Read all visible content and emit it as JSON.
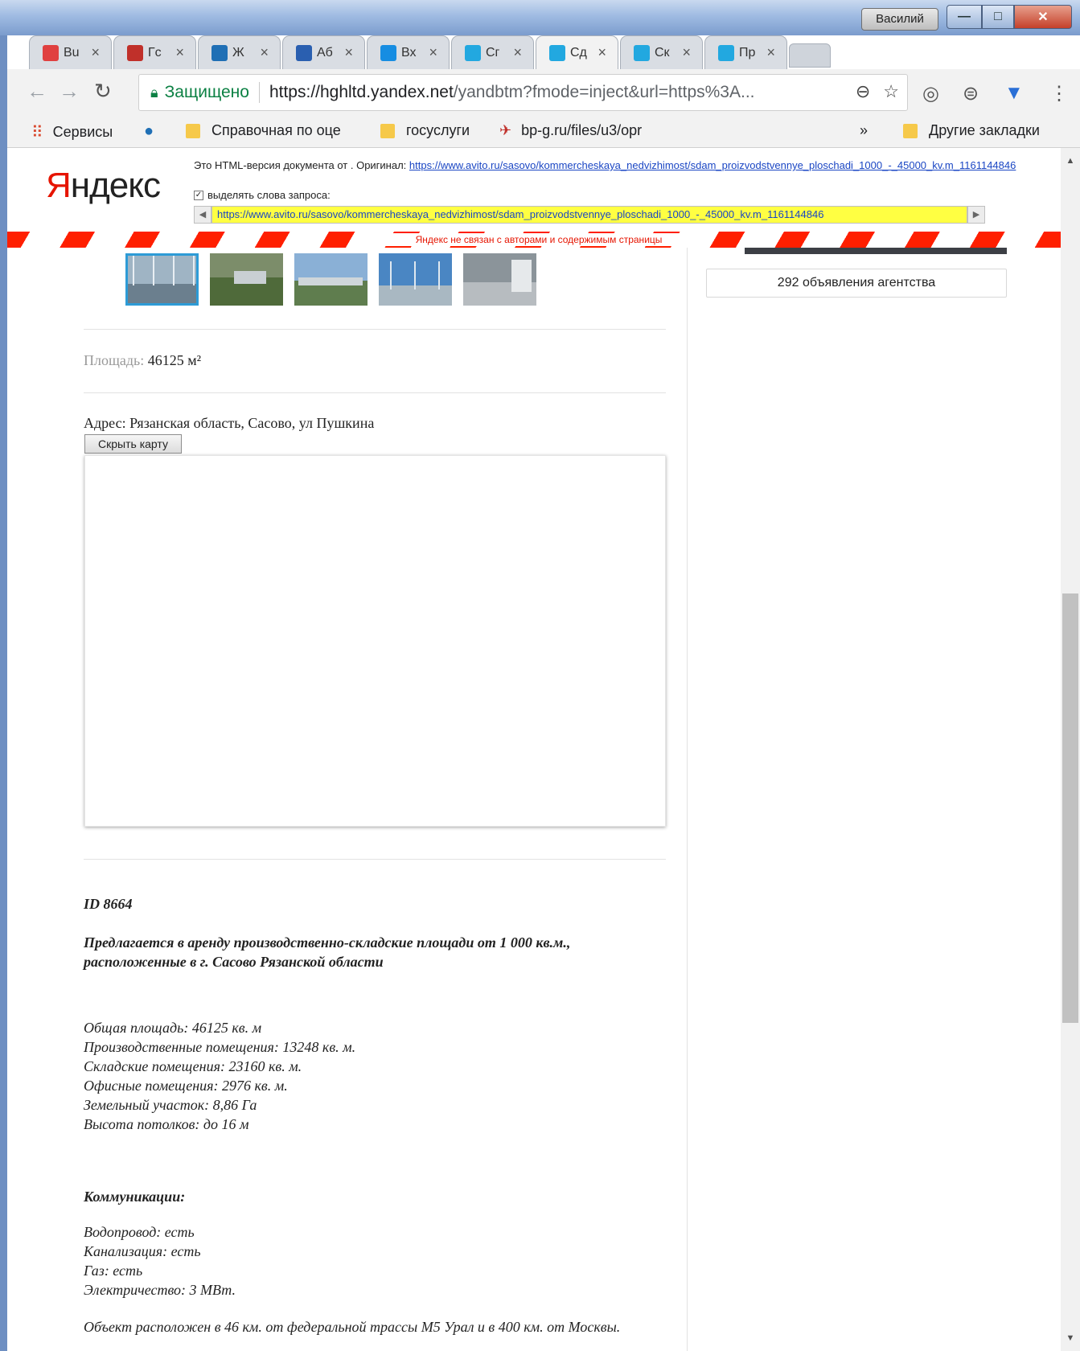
{
  "window": {
    "user_name": "Василий",
    "minimize": "—",
    "maximize": "□",
    "close": "✕"
  },
  "tabs": [
    {
      "label": "Bu",
      "icon": "stripe-icon",
      "color": "#e04040"
    },
    {
      "label": "Гс",
      "icon": "am-icon",
      "color": "#c0302a"
    },
    {
      "label": "Ж",
      "icon": "bird-icon",
      "color": "#1f6fb5"
    },
    {
      "label": "Аб",
      "icon": "person-icon",
      "color": "#2a5fb0"
    },
    {
      "label": "Вх",
      "icon": "mail-icon",
      "color": "#168de2"
    },
    {
      "label": "Сг",
      "icon": "paw-icon",
      "color": "#22a8e0"
    },
    {
      "label": "Сд",
      "icon": "paw-icon",
      "color": "#22a8e0",
      "active": true
    },
    {
      "label": "Ск",
      "icon": "paw-icon",
      "color": "#22a8e0"
    },
    {
      "label": "Пр",
      "icon": "paw-icon",
      "color": "#22a8e0"
    }
  ],
  "omnibox": {
    "secure_label": "Защищено",
    "url_host": "https://hghltd.yandex.net",
    "url_rest": "/yandbtm?fmode=inject&url=https%3A..."
  },
  "bookmarks": {
    "services": "Сервисы",
    "b1": "Справочная по оце",
    "b2": "госуслуги",
    "b3": "bp-g.ru/files/u3/opr",
    "more": "»",
    "other": "Другие закладки"
  },
  "yandex": {
    "logo_first": "Я",
    "logo_rest": "ндекс",
    "note_prefix": "Это HTML-версия документа от . Оригинал: ",
    "note_link": "https://www.avito.ru/sasovo/kommercheskaya_nedvizhimost/sdam_proizvodstvennye_ploschadi_1000_-_45000_kv.m_1161144846",
    "highlight_label": "выделять слова запроса:",
    "cached_url": "https://www.avito.ru/sasovo/kommercheskaya_nedvizhimost/sdam_proizvodstvennye_ploschadi_1000_-_45000_kv.m_1161144846",
    "disclaimer": "Яндекс не связан с авторами и содержимым страницы"
  },
  "listing": {
    "area_label": "Площадь:",
    "area_value": "46125 м²",
    "address": "Адрес: Рязанская область, Сасово, ул Пушкина",
    "hide_map": "Скрыть карту",
    "agency_ads": "292 объявления агентства",
    "id": "ID 8664",
    "headline_1": "Предлагается в аренду производственно-складские площади от 1 000 кв.м.,",
    "headline_2": "расположенные в г. Сасово Рязанской области",
    "specs": [
      "Общая площадь: 46125 кв. м",
      "Производственные помещения: 13248 кв. м.",
      "Складские помещения: 23160 кв. м.",
      "Офисные помещения: 2976 кв. м.",
      "Земельный участок: 8,86 Га",
      "Высота потолков: до 16 м"
    ],
    "comm_title": "Коммуникации:",
    "comm": [
      "Водопровод: есть",
      "Канализация: есть",
      "Газ: есть",
      "Электричество: 3 МВт."
    ],
    "location": "Объект расположен в 46 км. от федеральной трассы М5 Урал и в 400 км. от Москвы."
  }
}
